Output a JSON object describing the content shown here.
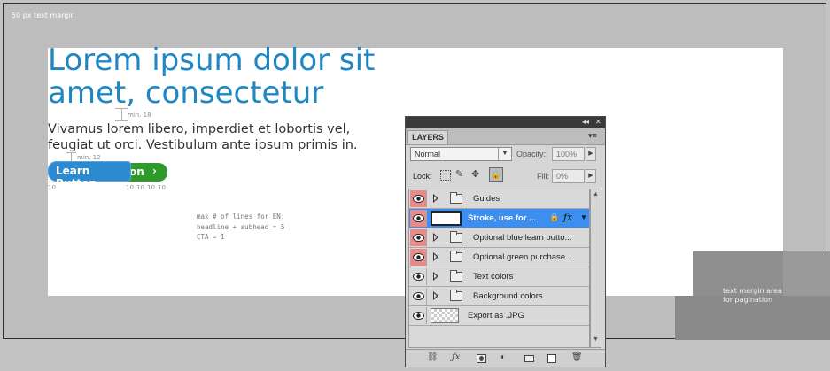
{
  "canvas": {
    "margin_label": "50 px text margin",
    "headline": [
      "Lorem ipsum dolor sit",
      "amet, consectetur"
    ],
    "subhead": [
      "Vivamus lorem libero, imperdiet et lobortis vel,",
      "feugiat ut orci. Vestibulum ante ipsum primis in."
    ],
    "min18": "min. 18",
    "min12": "min. 12",
    "green_button_label": "on",
    "green_button_chevron": "›",
    "blue_button_label": "Learn Button",
    "spacing_labels": [
      "10",
      "10",
      "10",
      "10",
      "10"
    ],
    "notes": [
      "max # of lines for EN:",
      "headline + subhead = 5",
      "CTA = 1"
    ],
    "pagination_label": [
      "text margin area",
      "for pagination"
    ]
  },
  "panel": {
    "titlebar_collapse": "◂◂",
    "titlebar_close": "✕",
    "tab_label": "LAYERS",
    "tab_menu": "▾≡",
    "blend_mode": "Normal",
    "opacity_label": "Opacity:",
    "opacity_value": "100%",
    "lock_label": "Lock:",
    "fill_label": "Fill:",
    "fill_value": "0%",
    "layers": [
      {
        "name": "Guides",
        "type": "group",
        "eye_highlight": true
      },
      {
        "name": "Stroke, use for ...",
        "type": "layer",
        "eye_highlight": true,
        "selected": true
      },
      {
        "name": "Optional blue learn butto...",
        "type": "group",
        "eye_highlight": true
      },
      {
        "name": "Optional green purchase...",
        "type": "group",
        "eye_highlight": true
      },
      {
        "name": "Text colors",
        "type": "group",
        "eye_highlight": false
      },
      {
        "name": "Background colors",
        "type": "group",
        "eye_highlight": false
      },
      {
        "name": "Export as .JPG",
        "type": "layer",
        "eye_highlight": false
      }
    ],
    "bottom_icons": [
      "link-icon",
      "fx-icon",
      "mask-icon",
      "adjustment-icon",
      "new-group-icon",
      "new-layer-icon",
      "trash-icon"
    ]
  },
  "colors": {
    "headline": "#1f87c3",
    "green_button": "#2e9a2c",
    "blue_button": "#2d8ad0",
    "selection": "#3c8ef0",
    "eye_highlight": "#e88a8a"
  }
}
